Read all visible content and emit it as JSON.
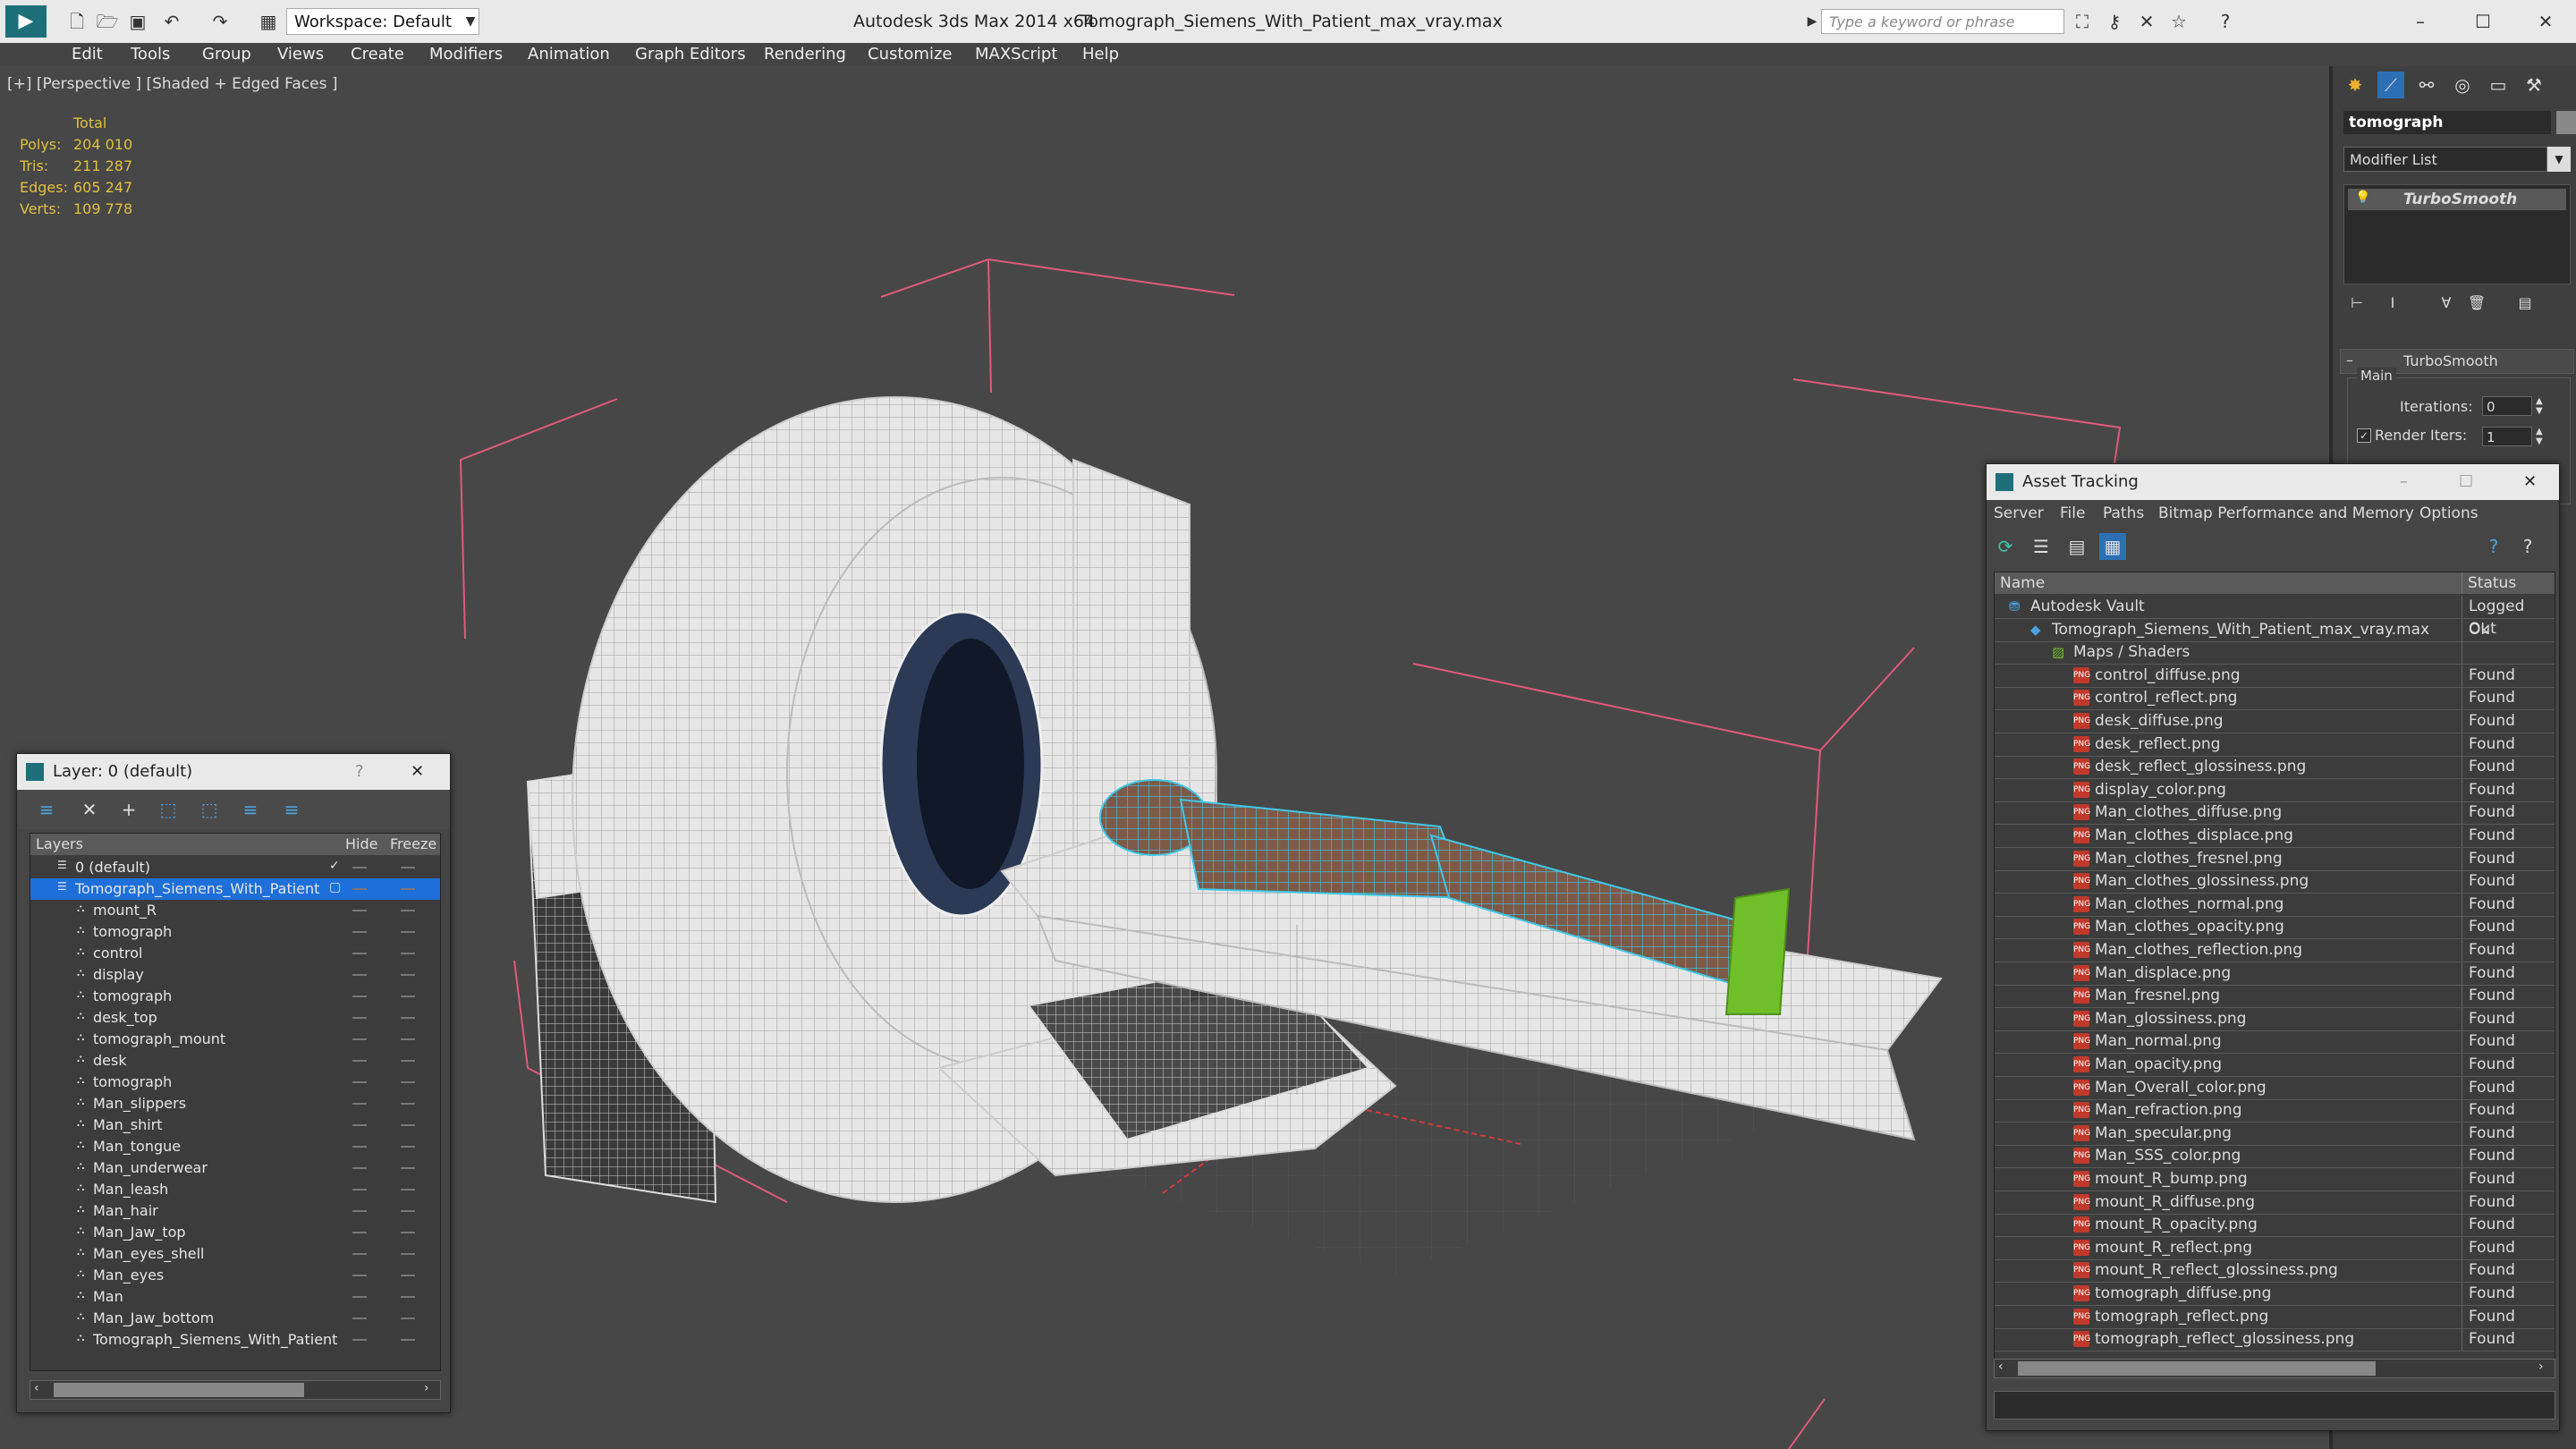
{
  "app": {
    "title": "Autodesk 3ds Max  2014 x64",
    "file": "Tomograph_Siemens_With_Patient_max_vray.max",
    "workspace": "Workspace: Default",
    "search_placeholder": "Type a keyword or phrase"
  },
  "menu": [
    "Edit",
    "Tools",
    "Group",
    "Views",
    "Create",
    "Modifiers",
    "Animation",
    "Graph Editors",
    "Rendering",
    "Customize",
    "MAXScript",
    "Help"
  ],
  "viewport": {
    "label": "[+] [Perspective ] [Shaded + Edged Faces ]",
    "stats": {
      "header": "Total",
      "rows": [
        {
          "label": "Polys:",
          "value": "204 010"
        },
        {
          "label": "Tris:",
          "value": "211 287"
        },
        {
          "label": "Edges:",
          "value": "605 247"
        },
        {
          "label": "Verts:",
          "value": "109 778"
        }
      ]
    }
  },
  "command_panel": {
    "object_name": "tomograph",
    "modifier_list": "Modifier List",
    "stack_item": "TurboSmooth",
    "rollout_title": "TurboSmooth",
    "group_main": "Main",
    "iterations_label": "Iterations:",
    "iterations_value": "0",
    "render_iters_label": "Render Iters:",
    "render_iters_value": "1"
  },
  "layer_window": {
    "title": "Layer: 0 (default)",
    "help": "?",
    "columns": {
      "layers": "Layers",
      "hide": "Hide",
      "freeze": "Freeze"
    },
    "layers": [
      {
        "name": "0 (default)",
        "level": 0
      },
      {
        "name": "Tomograph_Siemens_With_Patient",
        "level": 0,
        "selected": true
      },
      {
        "name": "mount_R",
        "level": 1
      },
      {
        "name": "tomograph",
        "level": 1
      },
      {
        "name": "control",
        "level": 1
      },
      {
        "name": "display",
        "level": 1
      },
      {
        "name": "tomograph",
        "level": 1
      },
      {
        "name": "desk_top",
        "level": 1
      },
      {
        "name": "tomograph_mount",
        "level": 1
      },
      {
        "name": "desk",
        "level": 1
      },
      {
        "name": "tomograph",
        "level": 1
      },
      {
        "name": "Man_slippers",
        "level": 1
      },
      {
        "name": "Man_shirt",
        "level": 1
      },
      {
        "name": "Man_tongue",
        "level": 1
      },
      {
        "name": "Man_underwear",
        "level": 1
      },
      {
        "name": "Man_leash",
        "level": 1
      },
      {
        "name": "Man_hair",
        "level": 1
      },
      {
        "name": "Man_Jaw_top",
        "level": 1
      },
      {
        "name": "Man_eyes_shell",
        "level": 1
      },
      {
        "name": "Man_eyes",
        "level": 1
      },
      {
        "name": "Man",
        "level": 1
      },
      {
        "name": "Man_Jaw_bottom",
        "level": 1
      },
      {
        "name": "Tomograph_Siemens_With_Patient",
        "level": 1
      }
    ]
  },
  "asset_window": {
    "title": "Asset Tracking",
    "menu": [
      "Server",
      "File",
      "Paths",
      "Bitmap Performance and Memory",
      "Options"
    ],
    "columns": {
      "name": "Name",
      "status": "Status"
    },
    "rows": [
      {
        "name": "Autodesk Vault",
        "status": "Logged Out",
        "level": 0,
        "type": "vault"
      },
      {
        "name": "Tomograph_Siemens_With_Patient_max_vray.max",
        "status": "Ok",
        "level": 1,
        "type": "max"
      },
      {
        "name": "Maps / Shaders",
        "status": "",
        "level": 2,
        "type": "folder"
      },
      {
        "name": "control_diffuse.png",
        "status": "Found",
        "level": 3,
        "type": "png"
      },
      {
        "name": "control_reflect.png",
        "status": "Found",
        "level": 3,
        "type": "png"
      },
      {
        "name": "desk_diffuse.png",
        "status": "Found",
        "level": 3,
        "type": "png"
      },
      {
        "name": "desk_reflect.png",
        "status": "Found",
        "level": 3,
        "type": "png"
      },
      {
        "name": "desk_reflect_glossiness.png",
        "status": "Found",
        "level": 3,
        "type": "png"
      },
      {
        "name": "display_color.png",
        "status": "Found",
        "level": 3,
        "type": "png"
      },
      {
        "name": "Man_clothes_diffuse.png",
        "status": "Found",
        "level": 3,
        "type": "png"
      },
      {
        "name": "Man_clothes_displace.png",
        "status": "Found",
        "level": 3,
        "type": "png"
      },
      {
        "name": "Man_clothes_fresnel.png",
        "status": "Found",
        "level": 3,
        "type": "png"
      },
      {
        "name": "Man_clothes_glossiness.png",
        "status": "Found",
        "level": 3,
        "type": "png"
      },
      {
        "name": "Man_clothes_normal.png",
        "status": "Found",
        "level": 3,
        "type": "png"
      },
      {
        "name": "Man_clothes_opacity.png",
        "status": "Found",
        "level": 3,
        "type": "png"
      },
      {
        "name": "Man_clothes_reflection.png",
        "status": "Found",
        "level": 3,
        "type": "png"
      },
      {
        "name": "Man_displace.png",
        "status": "Found",
        "level": 3,
        "type": "png"
      },
      {
        "name": "Man_fresnel.png",
        "status": "Found",
        "level": 3,
        "type": "png"
      },
      {
        "name": "Man_glossiness.png",
        "status": "Found",
        "level": 3,
        "type": "png"
      },
      {
        "name": "Man_normal.png",
        "status": "Found",
        "level": 3,
        "type": "png"
      },
      {
        "name": "Man_opacity.png",
        "status": "Found",
        "level": 3,
        "type": "png"
      },
      {
        "name": "Man_Overall_color.png",
        "status": "Found",
        "level": 3,
        "type": "png"
      },
      {
        "name": "Man_refraction.png",
        "status": "Found",
        "level": 3,
        "type": "png"
      },
      {
        "name": "Man_specular.png",
        "status": "Found",
        "level": 3,
        "type": "png"
      },
      {
        "name": "Man_SSS_color.png",
        "status": "Found",
        "level": 3,
        "type": "png"
      },
      {
        "name": "mount_R_bump.png",
        "status": "Found",
        "level": 3,
        "type": "png"
      },
      {
        "name": "mount_R_diffuse.png",
        "status": "Found",
        "level": 3,
        "type": "png"
      },
      {
        "name": "mount_R_opacity.png",
        "status": "Found",
        "level": 3,
        "type": "png"
      },
      {
        "name": "mount_R_reflect.png",
        "status": "Found",
        "level": 3,
        "type": "png"
      },
      {
        "name": "mount_R_reflect_glossiness.png",
        "status": "Found",
        "level": 3,
        "type": "png"
      },
      {
        "name": "tomograph_diffuse.png",
        "status": "Found",
        "level": 3,
        "type": "png"
      },
      {
        "name": "tomograph_reflect.png",
        "status": "Found",
        "level": 3,
        "type": "png"
      },
      {
        "name": "tomograph_reflect_glossiness.png",
        "status": "Found",
        "level": 3,
        "type": "png"
      }
    ]
  },
  "colors": {
    "selection": "#1e6fd9",
    "stat_text": "#e0c040",
    "bbox_lines": "#e05a7a",
    "wire_cyan": "#3ec8e8",
    "slipper_green": "#6fbf2a"
  }
}
